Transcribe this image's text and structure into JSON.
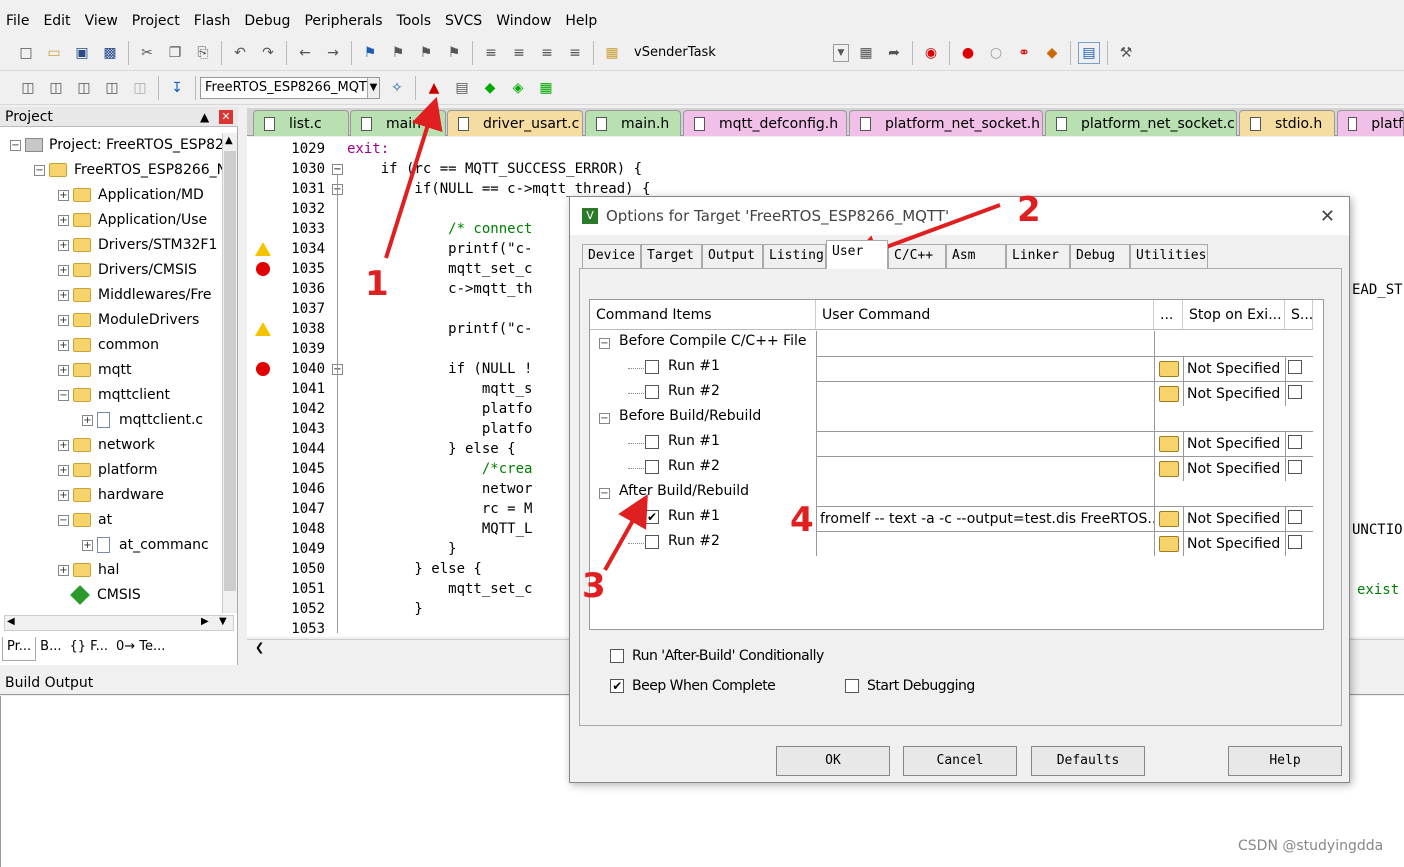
{
  "menu": [
    "File",
    "Edit",
    "View",
    "Project",
    "Flash",
    "Debug",
    "Peripherals",
    "Tools",
    "SVCS",
    "Window",
    "Help"
  ],
  "toolbar1": {
    "function_combo": "vSenderTask"
  },
  "toolbar2": {
    "target_combo": "FreeRTOS_ESP8266_MQT"
  },
  "project": {
    "title": "Project",
    "tree": [
      "Project: FreeRTOS_ESP82",
      "FreeRTOS_ESP8266_N",
      "Application/MD",
      "Application/Use",
      "Drivers/STM32F1",
      "Drivers/CMSIS",
      "Middlewares/Fre",
      "ModuleDrivers",
      "common",
      "mqtt",
      "mqttclient",
      "mqttclient.c",
      "network",
      "platform",
      "hardware",
      "at",
      "at_commanc",
      "hal",
      "CMSIS"
    ],
    "bottom_tabs": [
      "Pr...",
      "B...",
      "{} F...",
      "0→ Te..."
    ]
  },
  "file_tabs": [
    "list.c",
    "main",
    "driver_usart.c",
    "main.h",
    "mqtt_defconfig.h",
    "platform_net_socket.h",
    "platform_net_socket.c",
    "stdio.h",
    "platf"
  ],
  "editor": {
    "line_numbers": [
      "1029",
      "1030",
      "1031",
      "1032",
      "1033",
      "1034",
      "1035",
      "1036",
      "1037",
      "1038",
      "1039",
      "1040",
      "1041",
      "1042",
      "1043",
      "1044",
      "1045",
      "1046",
      "1047",
      "1048",
      "1049",
      "1050",
      "1051",
      "1052",
      "1053"
    ],
    "lines": [
      "exit:",
      "    if (rc == MQTT_SUCCESS_ERROR) {",
      "        if(NULL == c->mqtt_thread) {",
      "",
      "            /* connect",
      "            printf(\"c-",
      "            mqtt_set_c",
      "            c->mqtt_th",
      "",
      "            printf(\"c-",
      "",
      "            if (NULL !",
      "                mqtt_s",
      "                platfo",
      "                platfo",
      "            } else {",
      "                /*crea",
      "                networ",
      "                rc = M",
      "                MQTT_L",
      "            }",
      "        } else {",
      "            mqtt_set_c",
      "        }",
      ""
    ],
    "right_fragments": [
      "EAD_ST",
      "UNCTIO",
      "exist"
    ]
  },
  "build_output": {
    "title": "Build Output"
  },
  "dialog": {
    "title": "Options for Target 'FreeRTOS_ESP8266_MQTT'",
    "tabs": [
      "Device",
      "Target",
      "Output",
      "Listing",
      "User",
      "C/C++",
      "Asm",
      "Linker",
      "Debug",
      "Utilities"
    ],
    "columns": [
      "Command Items",
      "User Command",
      "...",
      "Stop on Exi...",
      "S..."
    ],
    "groups": [
      {
        "label": "Before Compile C/C++ File",
        "runs": [
          {
            "label": "Run #1",
            "checked": false,
            "command": "",
            "stop": "Not Specified"
          },
          {
            "label": "Run #2",
            "checked": false,
            "command": "",
            "stop": "Not Specified"
          }
        ]
      },
      {
        "label": "Before Build/Rebuild",
        "runs": [
          {
            "label": "Run #1",
            "checked": false,
            "command": "",
            "stop": "Not Specified"
          },
          {
            "label": "Run #2",
            "checked": false,
            "command": "",
            "stop": "Not Specified"
          }
        ]
      },
      {
        "label": "After Build/Rebuild",
        "runs": [
          {
            "label": "Run #1",
            "checked": true,
            "command": "fromelf -- text -a -c --output=test.dis  FreeRTOS...",
            "stop": "Not Specified"
          },
          {
            "label": "Run #2",
            "checked": false,
            "command": "",
            "stop": "Not Specified"
          }
        ]
      }
    ],
    "opt_after_build": "Run 'After-Build' Conditionally",
    "opt_after_build_checked": false,
    "opt_beep": "Beep When Complete",
    "opt_beep_checked": true,
    "opt_debug": "Start Debugging",
    "opt_debug_checked": false,
    "buttons": [
      "OK",
      "Cancel",
      "Defaults",
      "Help"
    ]
  },
  "annotations": [
    "1",
    "2",
    "3",
    "4"
  ],
  "watermark": "CSDN @studyingdda",
  "colors": {
    "annotation": "#e02020",
    "breakpoint": "#e00000",
    "keyword": "#0000ff",
    "comment": "#008000"
  }
}
